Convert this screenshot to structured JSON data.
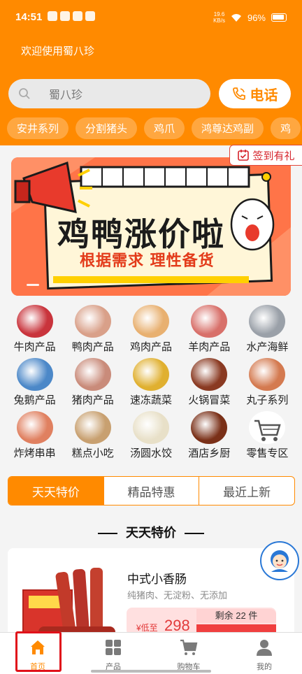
{
  "status_bar": {
    "time": "14:51",
    "net_speed_top": "19.6",
    "net_speed_unit": "KB/s",
    "battery": "96%"
  },
  "header": {
    "welcome": "欢迎使用蜀八珍",
    "search_placeholder": "蜀八珍",
    "phone_label": "电话"
  },
  "top_categories": [
    "安井系列",
    "分割猪头",
    "鸡爪",
    "鸿尊达鸡副",
    "鸡"
  ],
  "checkin_label": "签到有礼",
  "banner": {
    "title": "鸡鸭涨价啦",
    "subtitle": "根据需求  理性备货"
  },
  "grid": [
    {
      "label": "牛肉产品",
      "icon": "beef-icon",
      "color": "#c9343c"
    },
    {
      "label": "鸭肉产品",
      "icon": "duck-meat-icon",
      "color": "#d9a089"
    },
    {
      "label": "鸡肉产品",
      "icon": "chicken-icon",
      "color": "#e8b070"
    },
    {
      "label": "羊肉产品",
      "icon": "mutton-icon",
      "color": "#d8706a"
    },
    {
      "label": "水产海鲜",
      "icon": "shrimp-icon",
      "color": "#9aa0a8"
    },
    {
      "label": "兔鹅产品",
      "icon": "goose-icon",
      "color": "#4c88c8"
    },
    {
      "label": "猪肉产品",
      "icon": "pork-icon",
      "color": "#c98b7a"
    },
    {
      "label": "速冻蔬菜",
      "icon": "frozen-veg-icon",
      "color": "#e0b030"
    },
    {
      "label": "火锅冒菜",
      "icon": "hotpot-icon",
      "color": "#8a3a22"
    },
    {
      "label": "丸子系列",
      "icon": "meatball-icon",
      "color": "#d47a50"
    },
    {
      "label": "炸烤串串",
      "icon": "skewer-icon",
      "color": "#e08060"
    },
    {
      "label": "糕点小吃",
      "icon": "dumpling-icon",
      "color": "#c8a070"
    },
    {
      "label": "汤圆水饺",
      "icon": "tangyuan-icon",
      "color": "#e8e0c8"
    },
    {
      "label": "酒店乡厨",
      "icon": "braised-pork-icon",
      "color": "#7a3018"
    },
    {
      "label": "零售专区",
      "icon": "cart-icon",
      "color": "#ffffff"
    }
  ],
  "tabs": [
    "天天特价",
    "精品特惠",
    "最近上新"
  ],
  "section_title": "天天特价",
  "product": {
    "name": "中式小香肠",
    "desc": "纯猪肉、无淀粉、无添加",
    "price_prefix": "¥低至",
    "price": "298",
    "remaining": "剩余 22 件"
  },
  "bottom_nav": [
    {
      "label": "首页",
      "icon": "home-icon"
    },
    {
      "label": "产品",
      "icon": "grid-icon"
    },
    {
      "label": "购物车",
      "icon": "cart-icon"
    },
    {
      "label": "我的",
      "icon": "user-icon"
    }
  ],
  "colors": {
    "accent": "#ff8a00",
    "price_red": "#e23a3a",
    "highlight_box": "#e0111a"
  }
}
